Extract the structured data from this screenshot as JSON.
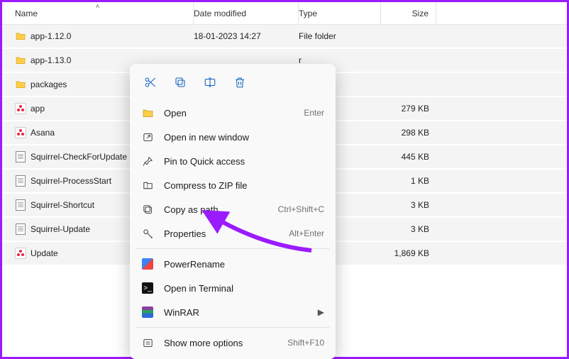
{
  "columns": {
    "name": "Name",
    "date": "Date modified",
    "type": "Type",
    "size": "Size"
  },
  "rows": [
    {
      "icon": "folder",
      "name": "app-1.12.0",
      "date": "18-01-2023 14:27",
      "type": "File folder",
      "size": ""
    },
    {
      "icon": "folder",
      "name": "app-1.13.0",
      "date": "",
      "type": "r",
      "size": ""
    },
    {
      "icon": "folder",
      "name": "packages",
      "date": "",
      "type": "r",
      "size": ""
    },
    {
      "icon": "app",
      "name": "app",
      "date": "",
      "type": "",
      "size": "279 KB"
    },
    {
      "icon": "app",
      "name": "Asana",
      "date": "",
      "type": "on",
      "size": "298 KB"
    },
    {
      "icon": "doc",
      "name": "Squirrel-CheckForUpdate",
      "date": "",
      "type": "ument",
      "size": "445 KB"
    },
    {
      "icon": "doc",
      "name": "Squirrel-ProcessStart",
      "date": "",
      "type": "ument",
      "size": "1 KB"
    },
    {
      "icon": "doc",
      "name": "Squirrel-Shortcut",
      "date": "",
      "type": "ument",
      "size": "3 KB"
    },
    {
      "icon": "doc",
      "name": "Squirrel-Update",
      "date": "",
      "type": "ument",
      "size": "3 KB"
    },
    {
      "icon": "app",
      "name": "Update",
      "date": "",
      "type": "on",
      "size": "1,869 KB"
    }
  ],
  "ctx": {
    "top": {
      "cut": "cut",
      "copy": "copy",
      "rename": "rename",
      "delete": "delete"
    },
    "open": "Open",
    "open_accel": "Enter",
    "open_new": "Open in new window",
    "pin": "Pin to Quick access",
    "zip": "Compress to ZIP file",
    "copypath": "Copy as path",
    "copypath_accel": "Ctrl+Shift+C",
    "properties": "Properties",
    "properties_accel": "Alt+Enter",
    "powerrename": "PowerRename",
    "terminal": "Open in Terminal",
    "winrar": "WinRAR",
    "showmore": "Show more options",
    "showmore_accel": "Shift+F10"
  }
}
